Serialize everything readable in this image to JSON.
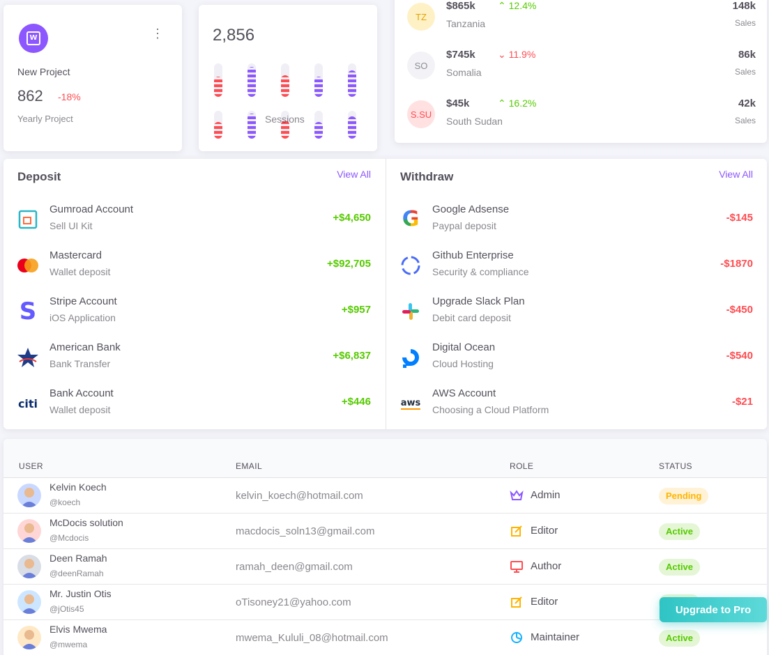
{
  "project_card": {
    "label": "New Project",
    "value": "862",
    "change": "-18%",
    "subtitle": "Yearly Project"
  },
  "sessions_card": {
    "value": "2,856",
    "label": "Sessions",
    "bars": [
      {
        "color": "#ff4c51",
        "level": 0.25
      },
      {
        "color": "#8c57ff",
        "level": 0.55
      },
      {
        "color": "#ff4c51",
        "level": 0.3
      },
      {
        "color": "#8c57ff",
        "level": 0.25
      },
      {
        "color": "#8c57ff",
        "level": 0.45
      }
    ]
  },
  "countries": [
    {
      "code": "TZ",
      "amount": "$865k",
      "trend": "up",
      "percent": "12.4%",
      "name": "Tanzania",
      "sales": "148k",
      "sales_label": "Sales",
      "flag_bg": "#fff1c6",
      "flag_fg": "#e0a400"
    },
    {
      "code": "SO",
      "amount": "$745k",
      "trend": "down",
      "percent": "11.9%",
      "name": "Somalia",
      "sales": "86k",
      "sales_label": "Sales",
      "flag_bg": "#f3f3f7",
      "flag_fg": "#8a8d93"
    },
    {
      "code": "S.SU",
      "amount": "$45k",
      "trend": "up",
      "percent": "16.2%",
      "name": "South Sudan",
      "sales": "42k",
      "sales_label": "Sales",
      "flag_bg": "#ffe1e2",
      "flag_fg": "#ff4c51"
    }
  ],
  "deposit": {
    "title": "Deposit",
    "view_all": "View All",
    "items": [
      {
        "title": "Gumroad Account",
        "subtitle": "Sell UI Kit",
        "amount": "+$4,650",
        "logo": "gumroad-logo"
      },
      {
        "title": "Mastercard",
        "subtitle": "Wallet deposit",
        "amount": "+$92,705",
        "logo": "mastercard-logo"
      },
      {
        "title": "Stripe Account",
        "subtitle": "iOS Application",
        "amount": "+$957",
        "logo": "stripe-logo"
      },
      {
        "title": "American Bank",
        "subtitle": "Bank Transfer",
        "amount": "+$6,837",
        "logo": "american-bank-logo"
      },
      {
        "title": "Bank Account",
        "subtitle": "Wallet deposit",
        "amount": "+$446",
        "logo": "citi-logo"
      }
    ]
  },
  "withdraw": {
    "title": "Withdraw",
    "view_all": "View All",
    "items": [
      {
        "title": "Google Adsense",
        "subtitle": "Paypal deposit",
        "amount": "-$145",
        "logo": "google-logo"
      },
      {
        "title": "Github Enterprise",
        "subtitle": "Security & compliance",
        "amount": "-$1870",
        "logo": "github-logo"
      },
      {
        "title": "Upgrade Slack Plan",
        "subtitle": "Debit card deposit",
        "amount": "-$450",
        "logo": "slack-logo"
      },
      {
        "title": "Digital Ocean",
        "subtitle": "Cloud Hosting",
        "amount": "-$540",
        "logo": "digitalocean-logo"
      },
      {
        "title": "AWS Account",
        "subtitle": "Choosing a Cloud Platform",
        "amount": "-$21",
        "logo": "aws-logo"
      }
    ]
  },
  "users_table": {
    "headers": {
      "user": "USER",
      "email": "EMAIL",
      "role": "ROLE",
      "status": "STATUS"
    },
    "rows": [
      {
        "name": "Kelvin Koech",
        "handle": "@koech",
        "email": "kelvin_koech@hotmail.com",
        "role": "Admin",
        "role_icon": "crown-icon",
        "role_color": "#8c57ff",
        "status": "Pending",
        "status_kind": "pending",
        "avatar_bg": "#c9d8ff"
      },
      {
        "name": "McDocis solution",
        "handle": "@Mcdocis",
        "email": "macdocis_soln13@gmail.com",
        "role": "Editor",
        "role_icon": "edit-icon",
        "role_color": "#ffb400",
        "status": "Active",
        "status_kind": "active",
        "avatar_bg": "#ffd6d6"
      },
      {
        "name": "Deen Ramah",
        "handle": "@deenRamah",
        "email": "ramah_deen@gmail.com",
        "role": "Author",
        "role_icon": "monitor-icon",
        "role_color": "#ff4c51",
        "status": "Active",
        "status_kind": "active",
        "avatar_bg": "#d9dde6"
      },
      {
        "name": "Mr. Justin Otis",
        "handle": "@jOtis45",
        "email": "oTisoney21@yahoo.com",
        "role": "Editor",
        "role_icon": "edit-icon",
        "role_color": "#ffb400",
        "status": "Active",
        "status_kind": "active",
        "avatar_bg": "#cde6ff"
      },
      {
        "name": "Elvis Mwema",
        "handle": "@mwema",
        "email": "mwema_Kululi_08@hotmail.com",
        "role": "Maintainer",
        "role_icon": "chart-icon",
        "role_color": "#16b1ff",
        "status": "Active",
        "status_kind": "active",
        "avatar_bg": "#ffe8c6"
      }
    ]
  },
  "upgrade_button": "Upgrade to Pro"
}
